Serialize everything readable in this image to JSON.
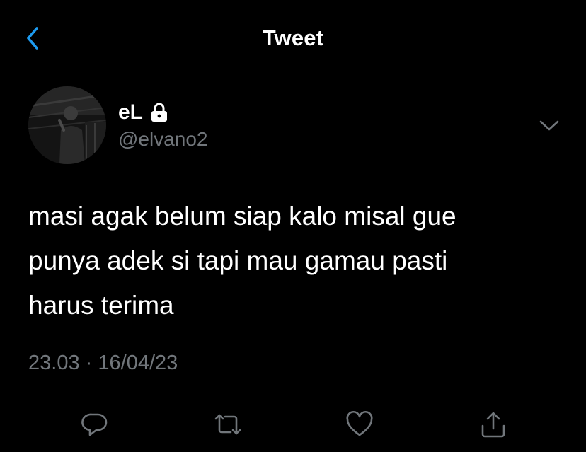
{
  "header": {
    "title": "Tweet"
  },
  "tweet": {
    "display_name": "eL",
    "handle": "@elvano2",
    "text": "masi agak belum siap kalo misal gue\npunya adek si tapi mau gamau pasti\nharus terima",
    "time": "23.03",
    "separator": "·",
    "date": "16/04/23"
  },
  "icons": {
    "back": "chevron-left-icon",
    "lock": "lock-icon",
    "more": "chevron-down-icon",
    "reply": "reply-icon",
    "retweet": "retweet-icon",
    "like": "heart-icon",
    "share": "share-icon"
  },
  "colors": {
    "background": "#000000",
    "accent": "#1d9bf0",
    "secondary_text": "#71767b",
    "divider": "#2f3336"
  }
}
